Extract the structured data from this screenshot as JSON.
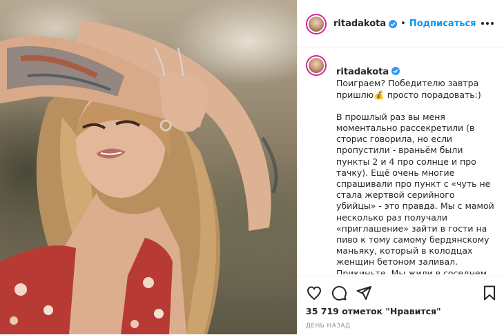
{
  "post": {
    "username": "ritadakota",
    "follow_label": "Подписаться",
    "dot": "•",
    "caption_lead": "Поиграем? Победителю завтра пришлю💰 просто порадовать:)",
    "caption_body": "В прошлый раз вы меня моментально рассекретили (в сторис говорила, но если пропустили - враньём были пункты 2 и 4 про солнце и про тачку). Ещё очень многие спрашивали про пункт с «чуть не стала жертвой серийного убийцы» - это правда. Мы с мамой несколько раз получали «приглашение» зайти в гости на пиво к тому самому бердянскому маньяку, который в колодцах женщин бетоном заливал. Прикиньте. Мы жили в соседнем доме 🏚 И он несколько раз звал нас",
    "likes_text": "35 719 отметок \"Нравится\"",
    "date_text": "ДЕНЬ НАЗАД"
  },
  "colors": {
    "accent": "#0095f6",
    "text": "#262626",
    "muted": "#8e8e8e",
    "border": "#efefef"
  },
  "icons": [
    "verified-icon",
    "more-icon",
    "heart-icon",
    "comment-icon",
    "share-icon",
    "bookmark-icon"
  ]
}
